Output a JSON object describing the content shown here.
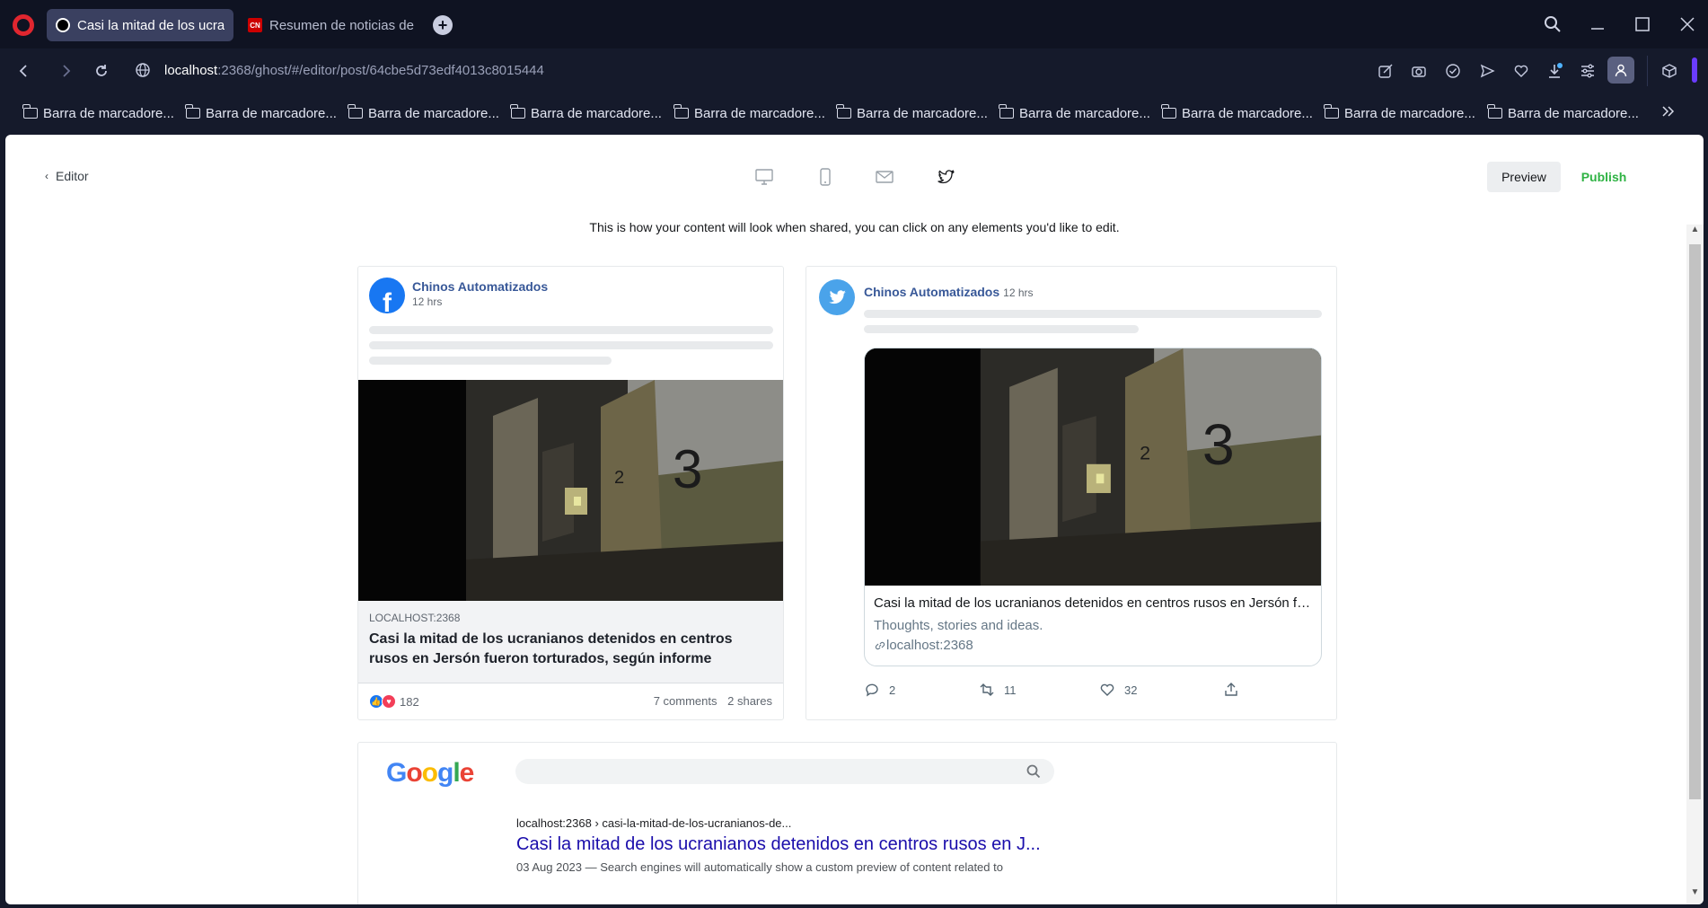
{
  "browser": {
    "tabs": [
      {
        "title": "Casi la mitad de los ucran"
      },
      {
        "title": "Resumen de noticias de la"
      }
    ],
    "url_host": "localhost",
    "url_rest": ":2368/ghost/#/editor/post/64cbe5d73edf4013c8015444",
    "bookmark_label": "Barra de marcadore...",
    "bookmarks": [
      "Barra de marcadore...",
      "Barra de marcadore...",
      "Barra de marcadore...",
      "Barra de marcadore...",
      "Barra de marcadore...",
      "Barra de marcadore...",
      "Barra de marcadore...",
      "Barra de marcadore...",
      "Barra de marcadore...",
      "Barra de marcadore..."
    ]
  },
  "header": {
    "back_label": "Editor",
    "preview_label": "Preview",
    "publish_label": "Publish",
    "hint": "This is how your content will look when shared, you can click on any elements you'd like to edit."
  },
  "facebook": {
    "name": "Chinos Automatizados",
    "time": "12 hrs",
    "domain": "LOCALHOST:2368",
    "title": "Casi la mitad de los ucranianos detenidos en centros rusos en Jersón fueron torturados, según informe",
    "reaction_count": "182",
    "comments": "7 comments",
    "shares": "2 shares"
  },
  "twitter": {
    "name": "Chinos Automatizados",
    "time": "12 hrs",
    "card_title": "Casi la mitad de los ucranianos detenidos en centros rusos en Jersón fueron torturados, según informe",
    "card_desc": "Thoughts, stories and ideas.",
    "card_link": "localhost:2368",
    "replies": "2",
    "retweets": "11",
    "likes": "32"
  },
  "google": {
    "logo": "Google",
    "url": "localhost:2368 › casi-la-mitad-de-los-ucranianos-de...",
    "title": "Casi la mitad de los ucranianos detenidos en centros rusos en J...",
    "snippet": "03 Aug 2023 — Search engines will automatically show a custom preview of content related to"
  },
  "colors": {
    "accent_green": "#2fb344",
    "facebook_blue": "#1877f2",
    "twitter_blue": "#4aa3ea",
    "google_link": "#1a0dab"
  }
}
